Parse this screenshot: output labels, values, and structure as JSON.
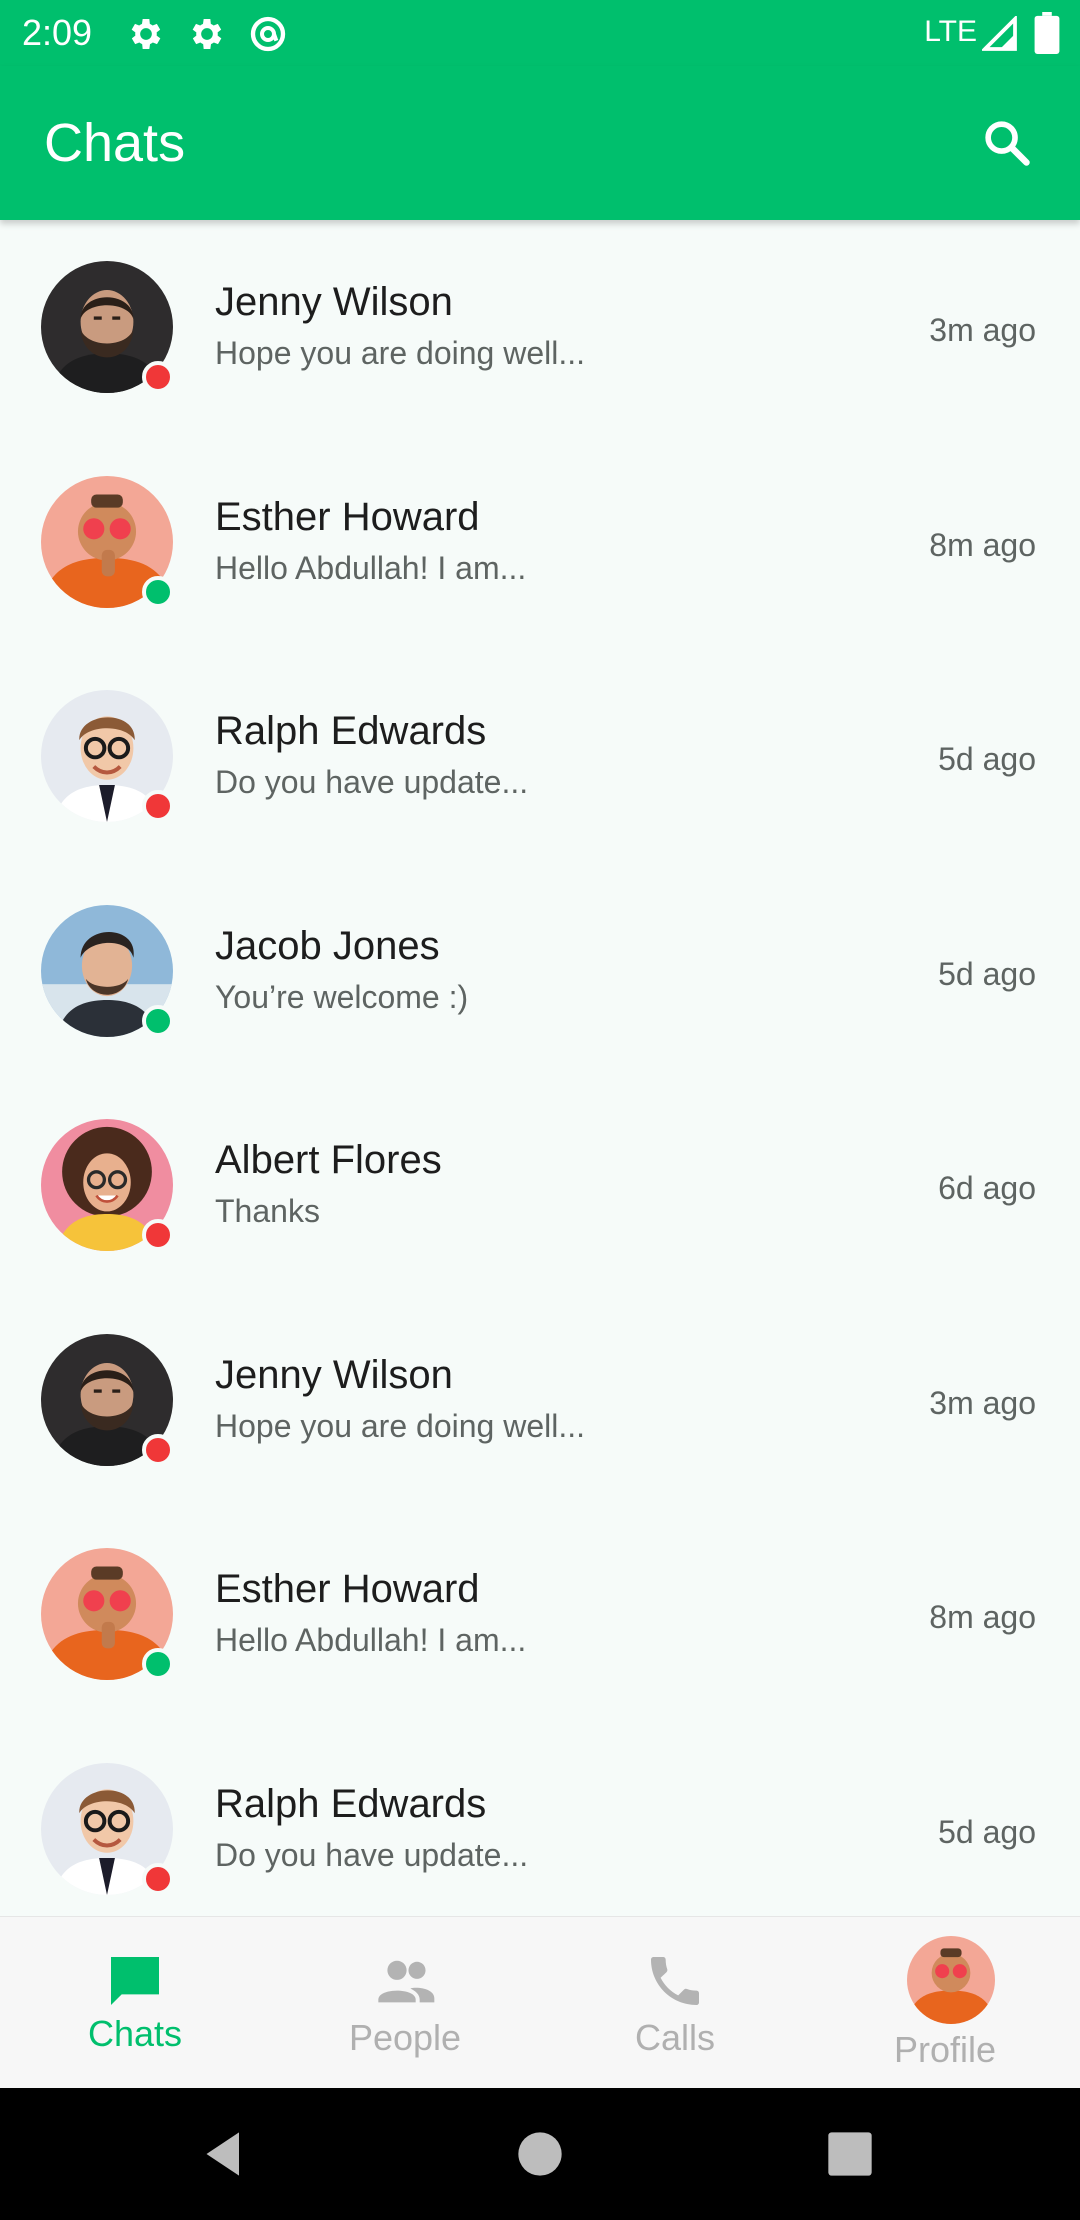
{
  "status_bar": {
    "time": "2:09",
    "network": "LTE"
  },
  "app_bar": {
    "title": "Chats"
  },
  "colors": {
    "brand": "#00BF6D",
    "online": "#00BF6D",
    "offline": "#F03738"
  },
  "chats": [
    {
      "name": "Jenny Wilson",
      "message": "Hope you are doing well...",
      "time": "3m ago",
      "status": "offline",
      "avatar": "bearded-man"
    },
    {
      "name": "Esther Howard",
      "message": "Hello Abdullah! I am...",
      "time": "8m ago",
      "status": "online",
      "avatar": "orange-hoodie"
    },
    {
      "name": "Ralph Edwards",
      "message": "Do you have update...",
      "time": "5d ago",
      "status": "offline",
      "avatar": "glasses-man"
    },
    {
      "name": "Jacob Jones",
      "message": "You’re welcome :)",
      "time": "5d ago",
      "status": "online",
      "avatar": "stylish-man"
    },
    {
      "name": "Albert Flores",
      "message": "Thanks",
      "time": "6d ago",
      "status": "offline",
      "avatar": "curly-woman"
    },
    {
      "name": "Jenny Wilson",
      "message": "Hope you are doing well...",
      "time": "3m ago",
      "status": "offline",
      "avatar": "bearded-man"
    },
    {
      "name": "Esther Howard",
      "message": "Hello Abdullah! I am...",
      "time": "8m ago",
      "status": "online",
      "avatar": "orange-hoodie"
    },
    {
      "name": "Ralph Edwards",
      "message": "Do you have update...",
      "time": "5d ago",
      "status": "offline",
      "avatar": "glasses-man"
    }
  ],
  "bottom_nav": {
    "chats": "Chats",
    "people": "People",
    "calls": "Calls",
    "profile": "Profile"
  }
}
